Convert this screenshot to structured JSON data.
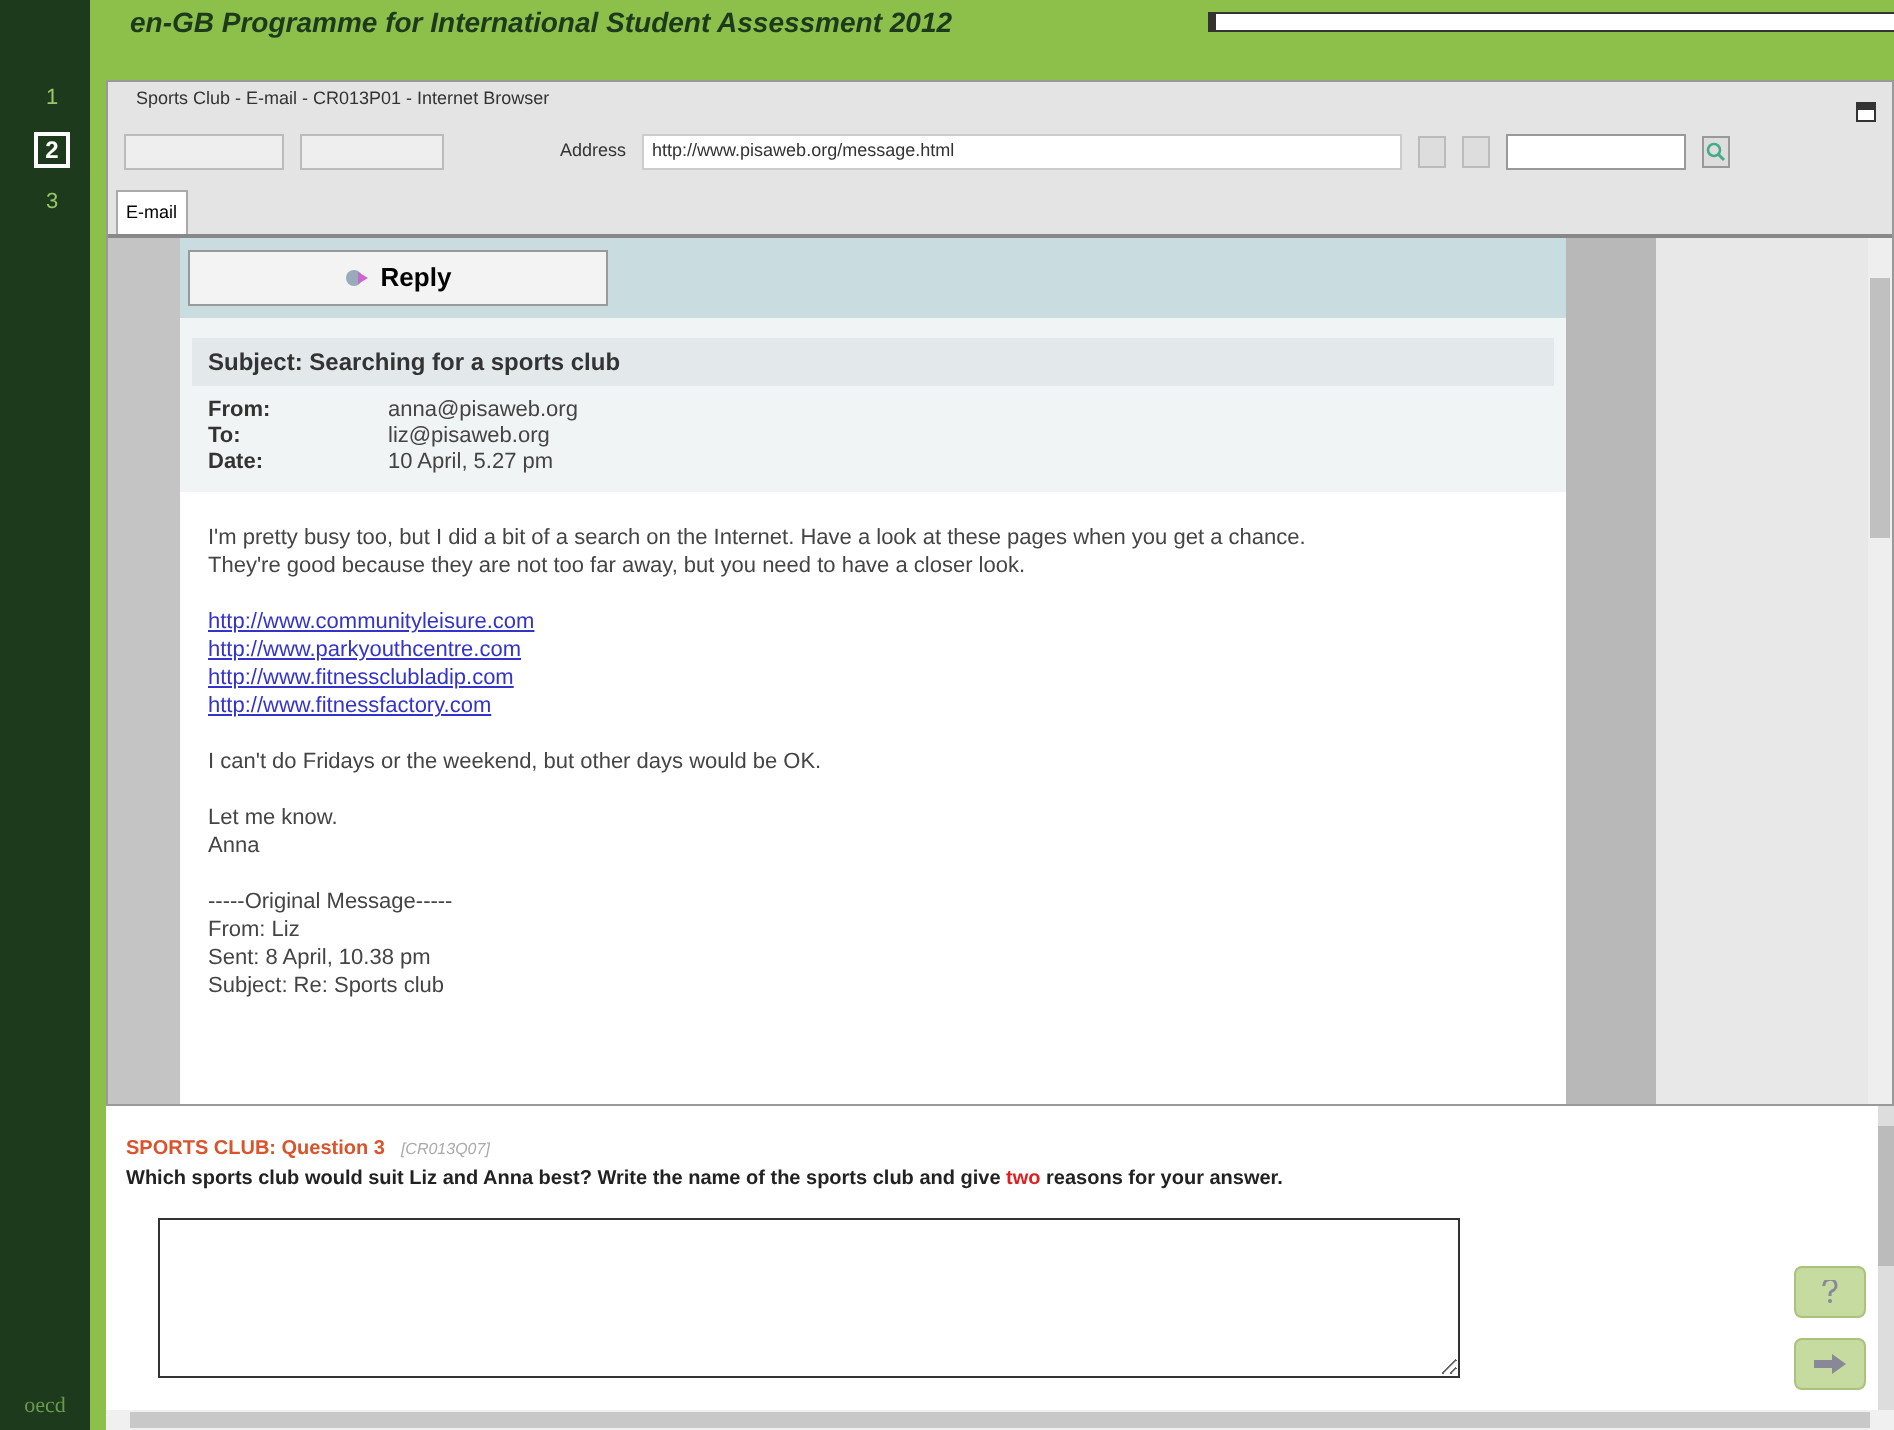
{
  "header": {
    "title": "en-GB Programme for International Student Assessment 2012",
    "progress": {
      "level": 0.01
    }
  },
  "steps": [
    {
      "label": "1",
      "selected": false
    },
    {
      "label": "2",
      "selected": true
    },
    {
      "label": "3",
      "selected": false
    }
  ],
  "logo": "oecd",
  "browser": {
    "title": "Sports Club - E-mail - CR013P01 - Internet Browser",
    "address_label": "Address",
    "address": "http://www.pisaweb.org/message.html",
    "tabs": [
      {
        "label": "E-mail",
        "selected": true
      }
    ]
  },
  "email": {
    "reply": "Reply",
    "subject": "Subject: Searching for a sports club",
    "headers": [
      {
        "label": "From:",
        "value": "anna@pisaweb.org"
      },
      {
        "label": "To:",
        "value": "liz@pisaweb.org"
      },
      {
        "label": "Date:",
        "value": "10 April, 5.27 pm"
      }
    ],
    "blocks": [
      {
        "kind": "text",
        "lines": [
          "I'm pretty busy too, but I did a bit of a search on the Internet. Have a look at these pages when you get a chance.",
          "They're good because they are not too far away, but you need to have a closer look."
        ]
      },
      {
        "kind": "links",
        "lines": [
          "http://www.communityleisure.com",
          "http://www.parkyouthcentre.com",
          "http://www.fitnessclubladip.com",
          "http://www.fitnessfactory.com"
        ]
      },
      {
        "kind": "text",
        "lines": [
          "I can't do Fridays or the weekend, but other days would be OK."
        ]
      },
      {
        "kind": "text",
        "lines": [
          "Let me know.",
          "Anna"
        ]
      },
      {
        "kind": "text",
        "lines": [
          "-----Original Message-----",
          "From: Liz",
          "Sent: 8 April, 10.38 pm",
          "Subject: Re: Sports club"
        ]
      }
    ]
  },
  "question": {
    "title": "SPORTS CLUB: Question 3",
    "code": "[CR013Q07]",
    "text": "Which sports club would suit Liz and Anna best? Write the name of the sports club and give *two* reasons for your answer."
  }
}
